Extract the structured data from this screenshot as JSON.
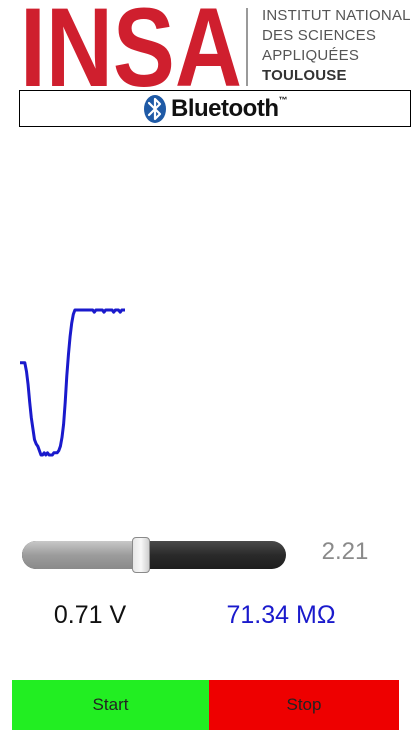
{
  "header": {
    "logo_letters": "INSA",
    "institution_lines": [
      "INSTITUT NATIONAL",
      "DES SCIENCES",
      "APPLIQUÉES"
    ],
    "city": "TOULOUSE",
    "logo_color": "#cf1f2e"
  },
  "bluetooth": {
    "icon": "bluetooth-icon",
    "label": "Bluetooth",
    "trademark": "™",
    "icon_color": "#1f5aa6"
  },
  "chart_data": {
    "type": "line",
    "line_color": "#1a1acc",
    "series": [
      {
        "values": [
          0.62,
          0.62,
          0.62,
          0.62,
          0.58,
          0.52,
          0.44,
          0.37,
          0.32,
          0.27,
          0.25,
          0.24,
          0.22,
          0.2,
          0.2,
          0.21,
          0.2,
          0.21,
          0.2,
          0.2,
          0.2,
          0.21,
          0.21,
          0.21,
          0.22,
          0.24,
          0.28,
          0.34,
          0.44,
          0.56,
          0.66,
          0.74,
          0.8,
          0.84,
          0.86,
          0.86,
          0.86,
          0.86,
          0.86,
          0.86,
          0.86,
          0.86,
          0.86,
          0.86,
          0.86,
          0.86,
          0.85,
          0.86,
          0.86,
          0.86,
          0.86,
          0.86,
          0.85,
          0.86,
          0.86,
          0.86,
          0.86,
          0.86,
          0.85,
          0.86,
          0.86,
          0.86,
          0.85,
          0.86,
          0.86,
          0.86
        ]
      }
    ]
  },
  "slider": {
    "value": 0.45,
    "value_label": "2.21"
  },
  "readings": {
    "voltage": "0.71 V",
    "resistance": "71.34  MΩ"
  },
  "buttons": {
    "start": "Start",
    "stop": "Stop",
    "start_color": "#22ee22",
    "stop_color": "#ee0000"
  }
}
